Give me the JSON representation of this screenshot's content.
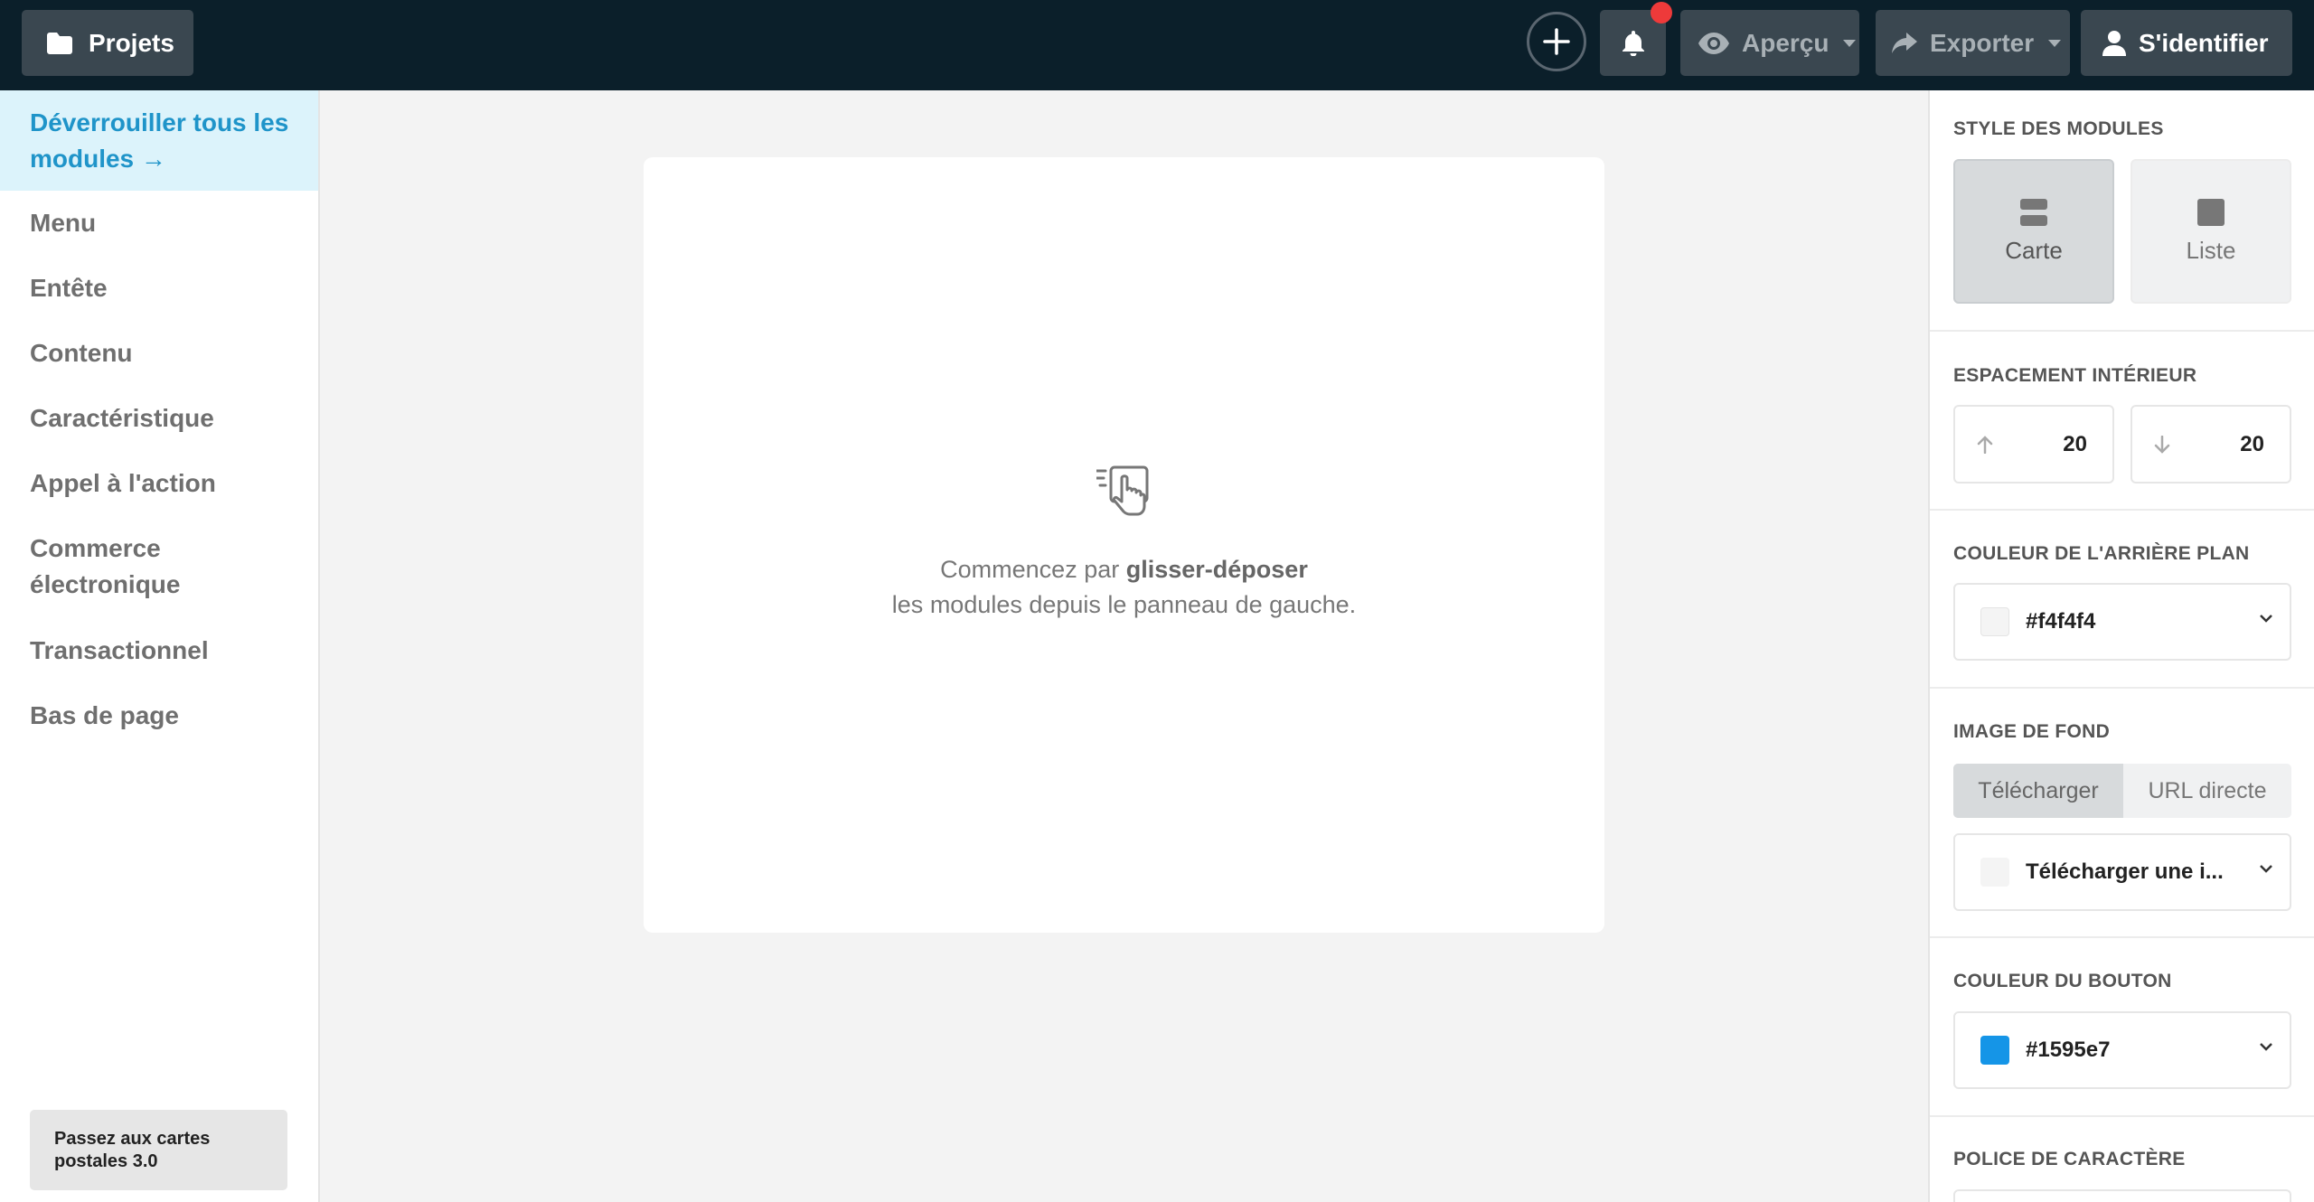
{
  "header": {
    "projects_label": "Projets",
    "preview_label": "Aperçu",
    "export_label": "Exporter",
    "login_label": "S'identifier",
    "notification_dot_color": "#ee3a3a"
  },
  "sidebar": {
    "unlock_label": "Déverrouiller tous les modules →",
    "items": [
      {
        "label": "Menu"
      },
      {
        "label": "Entête"
      },
      {
        "label": "Contenu"
      },
      {
        "label": "Caractéristique"
      },
      {
        "label": "Appel à l'action"
      },
      {
        "label": "Commerce électronique"
      },
      {
        "label": "Transactionnel"
      },
      {
        "label": "Bas de page"
      }
    ],
    "upgrade_label": "Passez aux cartes postales 3.0"
  },
  "canvas": {
    "drop_prefix": "Commencez par",
    "drop_bold": "glisser-déposer",
    "drop_line2": "les modules depuis le panneau de gauche."
  },
  "panel": {
    "module_style": {
      "title": "STYLE DES MODULES",
      "options": [
        "Carte",
        "Liste"
      ],
      "selected": "Carte"
    },
    "padding": {
      "title": "ESPACEMENT INTÉRIEUR",
      "top": "20",
      "bottom": "20"
    },
    "background_color": {
      "title": "COULEUR DE L'ARRIÈRE PLAN",
      "value": "#f4f4f4"
    },
    "background_image": {
      "title": "IMAGE DE FOND",
      "tabs": [
        "Télécharger",
        "URL directe"
      ],
      "selected_tab": "Télécharger",
      "select_label": "Télécharger une i..."
    },
    "button_color": {
      "title": "COULEUR DU BOUTON",
      "value": "#1595e7"
    },
    "font": {
      "title": "POLICE DE CARACTÈRE"
    }
  },
  "colors": {
    "topbar": "#0b1f2a",
    "accent": "#1f94c9",
    "swatch_bg": "#f4f4f4",
    "swatch_button": "#1595e7"
  }
}
